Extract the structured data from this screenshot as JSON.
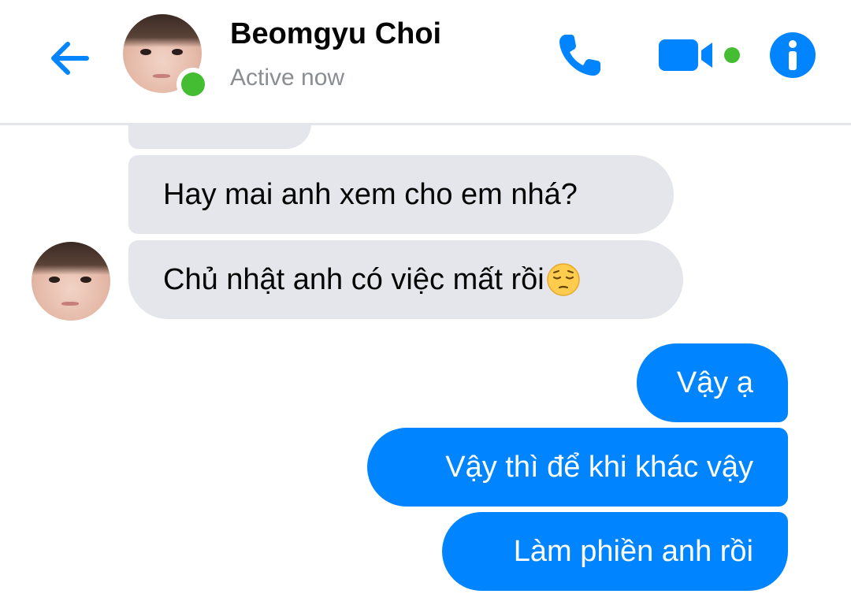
{
  "header": {
    "contact_name": "Beomgyu Choi",
    "status": "Active now"
  },
  "icons": {
    "back": "arrow-left-icon",
    "call": "phone-icon",
    "video": "video-camera-icon",
    "info": "info-icon",
    "emoji": "pensive-face-emoji"
  },
  "colors": {
    "accent": "#0084ff",
    "incoming_bubble": "#e4e6eb",
    "presence": "#44bd32",
    "status_text": "#8a8d91"
  },
  "messages": [
    {
      "direction": "incoming",
      "text": "Hay mai anh xem cho em nhá?"
    },
    {
      "direction": "incoming",
      "text": "Chủ nhật anh có việc mất rồi",
      "emoji": "😔"
    },
    {
      "direction": "outgoing",
      "text": "Vậy ạ"
    },
    {
      "direction": "outgoing",
      "text": "Vậy thì để khi khác vậy"
    },
    {
      "direction": "outgoing",
      "text": "Làm phiền anh rồi"
    }
  ]
}
